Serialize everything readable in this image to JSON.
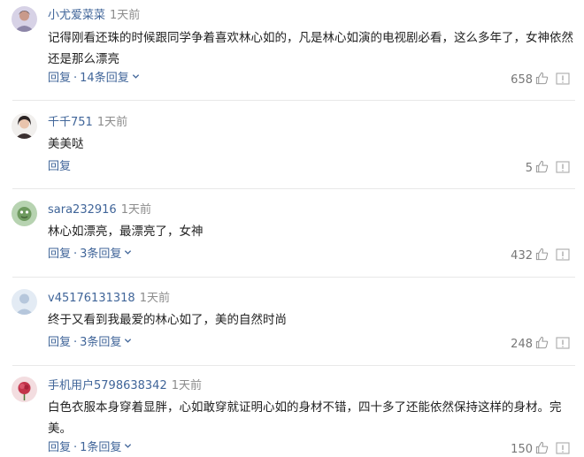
{
  "comments": [
    {
      "username": "小尤爱菜菜",
      "time": "1天前",
      "text": "记得刚看还珠的时候跟同学争着喜欢林心如的，凡是林心如演的电视剧必看，这么多年了，女神依然还是那么漂亮",
      "reply_label": "回复",
      "replies_label": "14条回复",
      "likes": "658"
    },
    {
      "username": "千千751",
      "time": "1天前",
      "text": "美美哒",
      "reply_label": "回复",
      "likes": "5"
    },
    {
      "username": "sara232916",
      "time": "1天前",
      "text": "林心如漂亮，最漂亮了，女神",
      "reply_label": "回复",
      "replies_label": "3条回复",
      "likes": "432"
    },
    {
      "username": "v45176131318",
      "time": "1天前",
      "text": "终于又看到我最爱的林心如了，美的自然时尚",
      "reply_label": "回复",
      "replies_label": "3条回复",
      "likes": "248"
    },
    {
      "username": "手机用户5798638342",
      "time": "1天前",
      "text": "白色衣服本身穿着显胖，心如敢穿就证明心如的身材不错，四十多了还能依然保持这样的身材。完美。",
      "reply_label": "回复",
      "replies_label": "1条回复",
      "likes": "150"
    }
  ],
  "icons": {
    "like": "thumbs-up-icon",
    "report": "report-icon",
    "expand": "chevron-down-icon"
  },
  "colors": {
    "link": "#406599",
    "meta": "#8c8c8c",
    "divider": "#e8e8e8"
  }
}
